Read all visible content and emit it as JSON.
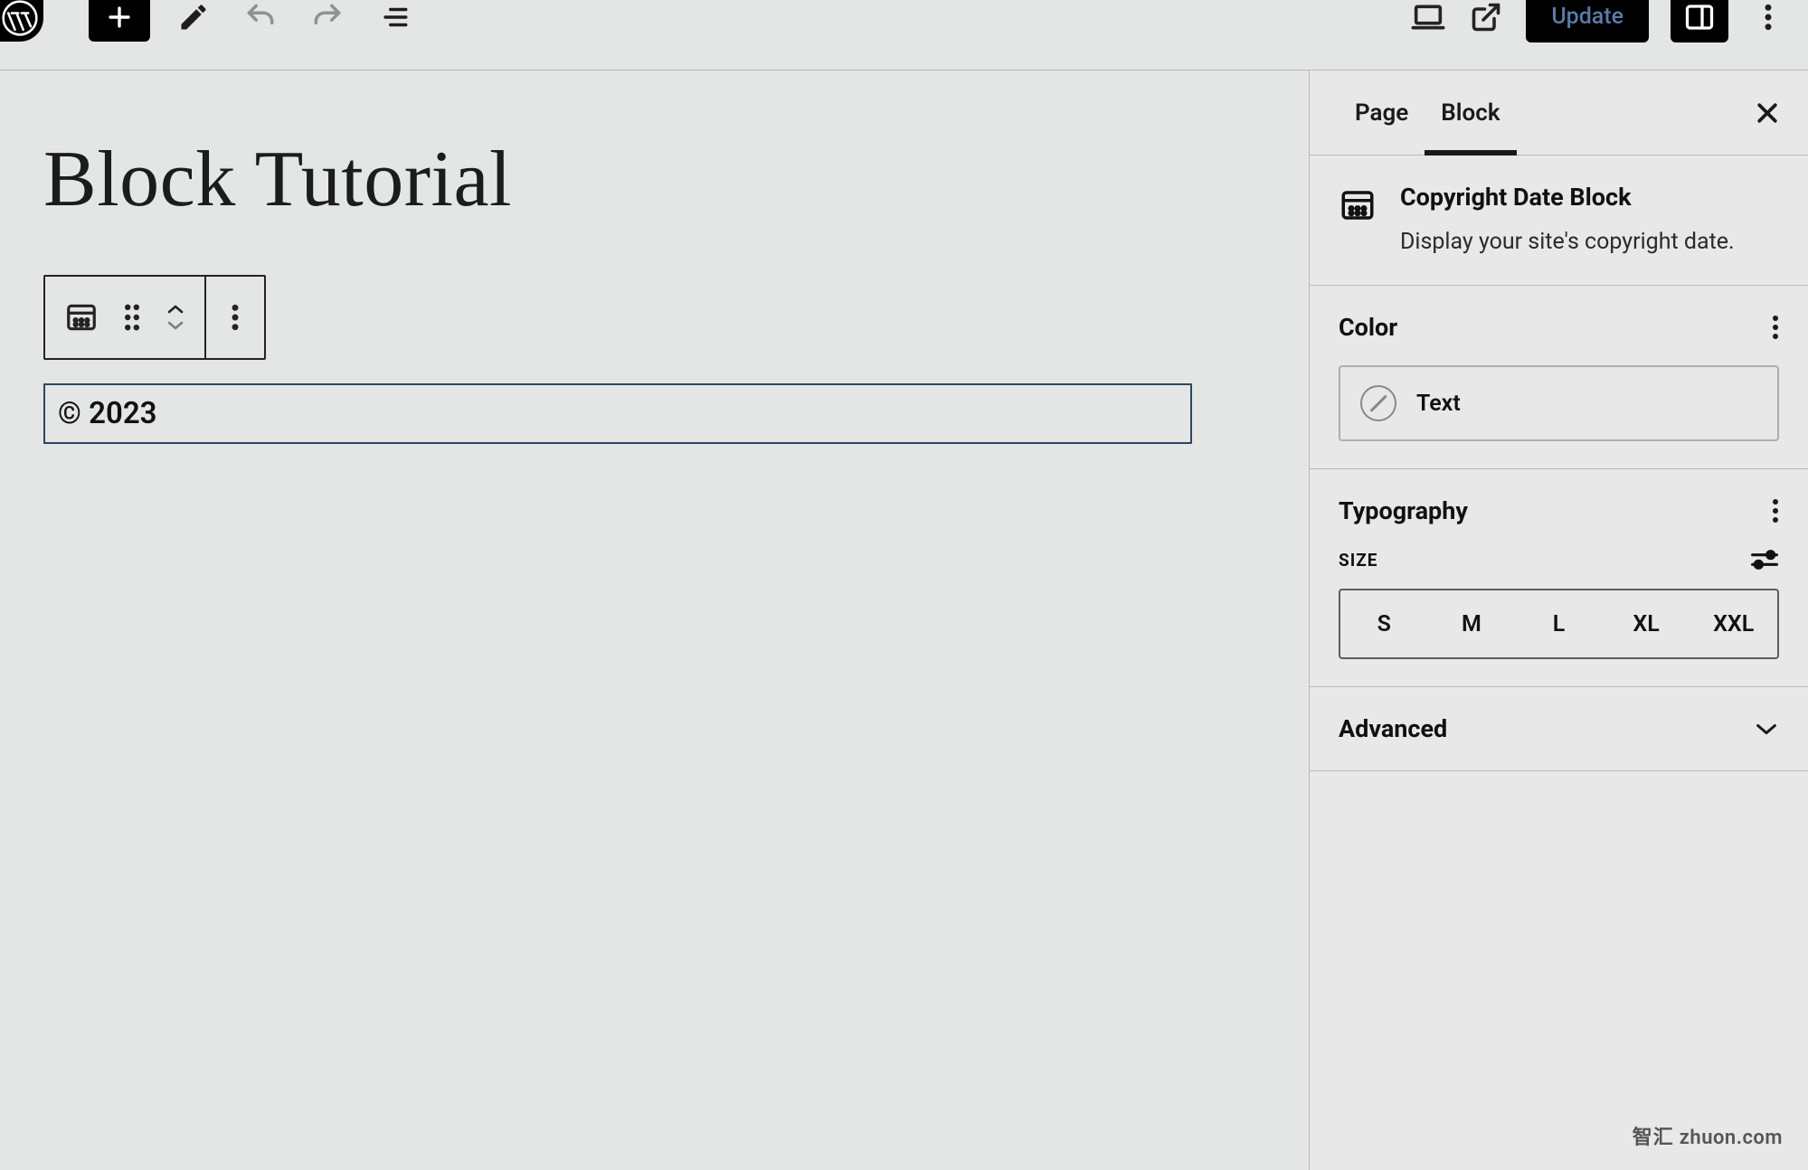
{
  "topbar": {
    "update_label": "Update"
  },
  "editor": {
    "page_title": "Block Tutorial",
    "selected_block_text": "© 2023"
  },
  "sidebar": {
    "tabs": {
      "page": "Page",
      "block": "Block"
    },
    "block_info": {
      "title": "Copyright Date Block",
      "description": "Display your site's copyright date."
    },
    "panels": {
      "color": {
        "title": "Color",
        "text_row_label": "Text"
      },
      "typography": {
        "title": "Typography",
        "size_label": "SIZE",
        "sizes": [
          "S",
          "M",
          "L",
          "XL",
          "XXL"
        ]
      },
      "advanced": {
        "title": "Advanced"
      }
    }
  },
  "watermark": {
    "cn": "智汇",
    "en": "zhuon.com"
  }
}
